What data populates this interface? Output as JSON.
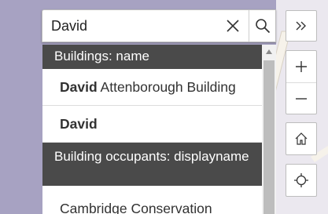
{
  "search": {
    "value": "David",
    "clear_icon": "close-icon",
    "search_icon": "search-icon"
  },
  "expand": {
    "icon": "double-chevron-right-icon"
  },
  "suggestions": {
    "groups": [
      {
        "header": "Buildings: name",
        "items": [
          {
            "match": "David",
            "rest": " Attenborough Building"
          },
          {
            "match": "David",
            "rest": ""
          }
        ]
      },
      {
        "header": "Building occupants: displayname",
        "items": [
          {
            "match": "",
            "rest": "Cambridge Conservation"
          }
        ]
      }
    ]
  },
  "map_controls": {
    "zoom_in_icon": "plus-icon",
    "zoom_out_icon": "minus-icon",
    "home_icon": "home-icon",
    "locate_icon": "crosshair-icon"
  },
  "colors": {
    "map_background": "#a7a2c2",
    "group_header": "#4a4a4a",
    "road": "#f6f2ea"
  }
}
